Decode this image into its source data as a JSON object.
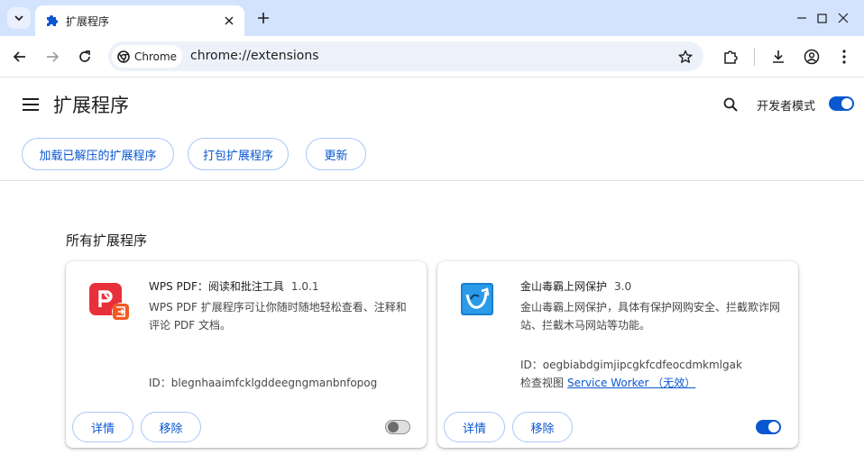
{
  "tab": {
    "title": "扩展程序"
  },
  "omnibox": {
    "chip_label": "Chrome",
    "url": "chrome://extensions"
  },
  "header": {
    "title": "扩展程序",
    "dev_mode_label": "开发者模式",
    "dev_mode_enabled": true
  },
  "actions": {
    "load_unpacked": "加载已解压的扩展程序",
    "pack": "打包扩展程序",
    "update": "更新"
  },
  "section_title": "所有扩展程序",
  "extensions": [
    {
      "name": "WPS PDF：阅读和批注工具",
      "version": "1.0.1",
      "description": "WPS PDF 扩展程序可让你随时随地轻松查看、注释和评论 PDF 文档。",
      "id_text": "ID：blegnhaaimfcklgddeegngmanbnfopog",
      "details_label": "详情",
      "remove_label": "移除",
      "enabled": false,
      "icon": "wps-pdf-icon"
    },
    {
      "name": "金山毒霸上网保护",
      "version": "3.0",
      "description": "金山毒霸上网保护，具体有保护网购安全、拦截欺诈网站、拦截木马网站等功能。",
      "id_text": "ID：oegbiabdgimjipcgkfcdfeocdmkmlgak",
      "inspect_label": "检查视图",
      "inspect_link": "Service Worker （无效）",
      "details_label": "详情",
      "remove_label": "移除",
      "enabled": true,
      "icon": "duba-shield-icon"
    }
  ],
  "colors": {
    "accent": "#0b57d0",
    "tabstrip": "#d3e3fd",
    "wps_red": "#e8303b",
    "duba_blue": "#1a7fd0"
  }
}
